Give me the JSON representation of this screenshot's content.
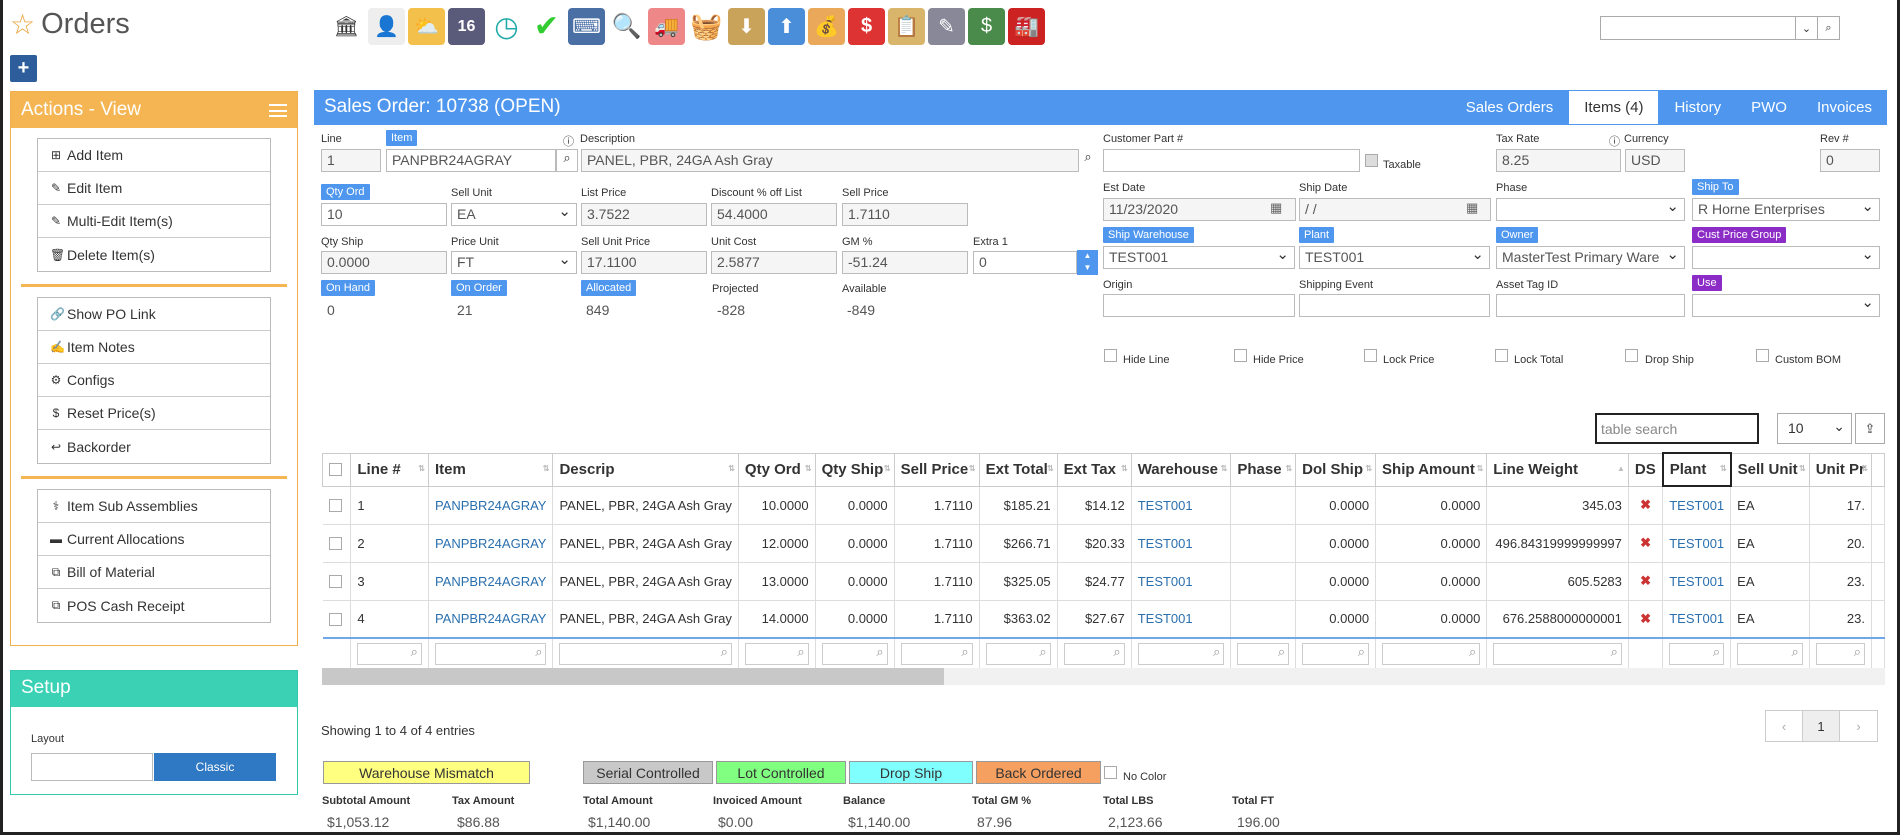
{
  "header": {
    "title": "Orders",
    "toolbar_icons": [
      "bank-icon",
      "user-icon",
      "weather-icon",
      "calendar-icon",
      "clock-icon",
      "check-icon",
      "keyboard-icon",
      "search-icon",
      "truck-icon",
      "basket-icon",
      "download-icon",
      "upload-icon",
      "cash-stack-icon",
      "dollar-chat-icon",
      "clipboard-icon",
      "edit-icon",
      "money-icon",
      "factory-icon"
    ],
    "calendar_day": "16",
    "search_placeholder": ""
  },
  "actions": {
    "title": "Actions - View",
    "group1": [
      {
        "icon": "plus-square-icon",
        "glyph": "⊞",
        "label": "Add Item"
      },
      {
        "icon": "pencil-icon",
        "glyph": "✎",
        "label": "Edit Item"
      },
      {
        "icon": "pencil-icon",
        "glyph": "✎",
        "label": "Multi-Edit Item(s)"
      },
      {
        "icon": "trash-icon",
        "glyph": "🗑",
        "label": "Delete Item(s)"
      }
    ],
    "group2": [
      {
        "icon": "link-icon",
        "glyph": "🔗",
        "label": "Show PO Link"
      },
      {
        "icon": "note-icon",
        "glyph": "✍",
        "label": "Item Notes"
      },
      {
        "icon": "cogs-icon",
        "glyph": "⚙",
        "label": "Configs"
      },
      {
        "icon": "dollar-icon",
        "glyph": "$",
        "label": "Reset Price(s)"
      },
      {
        "icon": "reply-icon",
        "glyph": "↩",
        "label": "Backorder"
      }
    ],
    "group3": [
      {
        "icon": "sitemap-icon",
        "glyph": "⚕",
        "label": "Item Sub Assemblies"
      },
      {
        "icon": "archive-icon",
        "glyph": "▬",
        "label": "Current Allocations"
      },
      {
        "icon": "external-icon",
        "glyph": "⧉",
        "label": "Bill of Material"
      },
      {
        "icon": "external-icon",
        "glyph": "⧉",
        "label": "POS Cash Receipt"
      }
    ]
  },
  "setup": {
    "title": "Setup",
    "layout_label": "Layout",
    "classic_label": "Classic"
  },
  "order": {
    "title": "Sales Order: 10738 (OPEN)",
    "tabs": [
      "Sales Orders",
      "Items (4)",
      "History",
      "PWO",
      "Invoices"
    ]
  },
  "form": {
    "line_label": "Line",
    "line": "1",
    "item_label": "Item",
    "item": "PANPBR24AGRAY",
    "desc_label": "Description",
    "desc": "PANEL, PBR, 24GA Ash Gray",
    "cust_part_label": "Customer Part #",
    "cust_part": "",
    "taxable_label": "Taxable",
    "tax_rate_label": "Tax Rate",
    "tax_rate": "8.25",
    "currency_label": "Currency",
    "currency": "USD",
    "rev_label": "Rev #",
    "rev": "0",
    "qty_ord_label": "Qty Ord",
    "qty_ord": "10",
    "sell_unit_label": "Sell Unit",
    "sell_unit": "EA",
    "list_price_label": "List Price",
    "list_price": "3.7522",
    "discount_label": "Discount % off List",
    "discount": "54.4000",
    "sell_price_label": "Sell Price",
    "sell_price": "1.7110",
    "est_date_label": "Est Date",
    "est_date": "11/23/2020",
    "ship_date_label": "Ship Date",
    "ship_date": " /  /",
    "phase_label": "Phase",
    "phase": "",
    "ship_to_label": "Ship To",
    "ship_to": "R Horne Enterprises",
    "qty_ship_label": "Qty Ship",
    "qty_ship": "0.0000",
    "price_unit_label": "Price Unit",
    "price_unit": "FT",
    "sell_unit_price_label": "Sell Unit Price",
    "sell_unit_price": "17.1100",
    "unit_cost_label": "Unit Cost",
    "unit_cost": "2.5877",
    "gm_label": "GM %",
    "gm": "-51.24",
    "extra1_label": "Extra 1",
    "extra1": "0",
    "ship_wh_label": "Ship Warehouse",
    "ship_wh": "TEST001",
    "plant_label": "Plant",
    "plant": "TEST001",
    "owner_label": "Owner",
    "owner": "MasterTest Primary Ware",
    "cust_price_group_label": "Cust Price Group",
    "cust_price_group": "",
    "on_hand_label": "On Hand",
    "on_hand": "0",
    "on_order_label": "On Order",
    "on_order": "21",
    "allocated_label": "Allocated",
    "allocated": "849",
    "projected_label": "Projected",
    "projected": "-828",
    "available_label": "Available",
    "available": "-849",
    "origin_label": "Origin",
    "origin": "",
    "shipping_event_label": "Shipping Event",
    "shipping_event": "",
    "asset_tag_label": "Asset Tag ID",
    "asset_tag": "",
    "use_label": "Use",
    "use": "",
    "checkboxes": [
      "Hide Line",
      "Hide Price",
      "Lock Price",
      "Lock Total",
      "Drop Ship",
      "Custom BOM"
    ]
  },
  "table": {
    "search_placeholder": "table search",
    "page_size": "10",
    "columns": [
      "Line #",
      "Item",
      "Descrip",
      "Qty Ord",
      "Qty Ship",
      "Sell Price",
      "Ext Total",
      "Ext Tax",
      "Warehouse",
      "Phase",
      "Dol Ship",
      "Ship Amount",
      "Line Weight",
      "DS",
      "Plant",
      "Sell Unit",
      "Unit Pr"
    ],
    "rows": [
      {
        "line": "1",
        "item": "PANPBR24AGRAY",
        "descrip": "PANEL, PBR, 24GA Ash Gray",
        "qty_ord": "10.0000",
        "qty_ship": "0.0000",
        "sell_price": "1.7110",
        "ext_total": "$185.21",
        "ext_tax": "$14.12",
        "warehouse": "TEST001",
        "phase": "",
        "dol_ship": "0.0000",
        "ship_amount": "0.0000",
        "line_weight": "345.03",
        "ds": "✖",
        "plant": "TEST001",
        "sell_unit": "EA",
        "unit_pr": "17."
      },
      {
        "line": "2",
        "item": "PANPBR24AGRAY",
        "descrip": "PANEL, PBR, 24GA Ash Gray",
        "qty_ord": "12.0000",
        "qty_ship": "0.0000",
        "sell_price": "1.7110",
        "ext_total": "$266.71",
        "ext_tax": "$20.33",
        "warehouse": "TEST001",
        "phase": "",
        "dol_ship": "0.0000",
        "ship_amount": "0.0000",
        "line_weight": "496.84319999999997",
        "ds": "✖",
        "plant": "TEST001",
        "sell_unit": "EA",
        "unit_pr": "20."
      },
      {
        "line": "3",
        "item": "PANPBR24AGRAY",
        "descrip": "PANEL, PBR, 24GA Ash Gray",
        "qty_ord": "13.0000",
        "qty_ship": "0.0000",
        "sell_price": "1.7110",
        "ext_total": "$325.05",
        "ext_tax": "$24.77",
        "warehouse": "TEST001",
        "phase": "",
        "dol_ship": "0.0000",
        "ship_amount": "0.0000",
        "line_weight": "605.5283",
        "ds": "✖",
        "plant": "TEST001",
        "sell_unit": "EA",
        "unit_pr": "23."
      },
      {
        "line": "4",
        "item": "PANPBR24AGRAY",
        "descrip": "PANEL, PBR, 24GA Ash Gray",
        "qty_ord": "14.0000",
        "qty_ship": "0.0000",
        "sell_price": "1.7110",
        "ext_total": "$363.02",
        "ext_tax": "$27.67",
        "warehouse": "TEST001",
        "phase": "",
        "dol_ship": "0.0000",
        "ship_amount": "0.0000",
        "line_weight": "676.2588000000001",
        "ds": "✖",
        "plant": "TEST001",
        "sell_unit": "EA",
        "unit_pr": "23."
      }
    ],
    "showing": "Showing 1 to 4 of 4 entries",
    "pager": [
      "‹",
      "1",
      "›"
    ]
  },
  "legend": [
    {
      "label": "Warehouse Mismatch",
      "color": "#ffff80"
    },
    {
      "label": "Serial Controlled",
      "color": "#c8c8c8"
    },
    {
      "label": "Lot Controlled",
      "color": "#80ff80"
    },
    {
      "label": "Drop Ship",
      "color": "#80ffff"
    },
    {
      "label": "Back Ordered",
      "color": "#f5a060"
    }
  ],
  "no_color_label": "No Color",
  "totals": [
    {
      "label": "Subtotal Amount",
      "value": "$1,053.12"
    },
    {
      "label": "Tax Amount",
      "value": "$86.88"
    },
    {
      "label": "Total Amount",
      "value": "$1,140.00"
    },
    {
      "label": "Invoiced Amount",
      "value": "$0.00"
    },
    {
      "label": "Balance",
      "value": "$1,140.00"
    },
    {
      "label": "Total GM %",
      "value": "87.96"
    },
    {
      "label": "Total LBS",
      "value": "2,123.66"
    },
    {
      "label": "Total FT",
      "value": "196.00"
    }
  ]
}
